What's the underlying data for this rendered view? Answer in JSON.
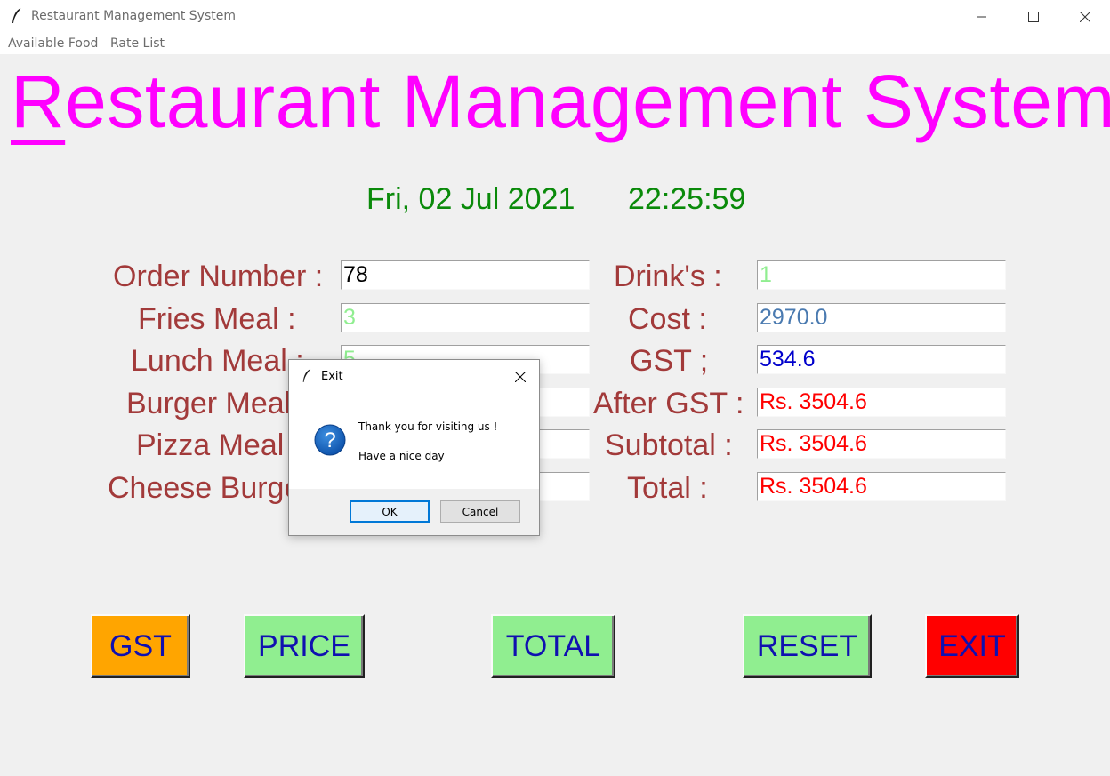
{
  "window": {
    "title": "Restaurant Management System"
  },
  "menu": {
    "items": [
      "Available Food",
      "Rate List"
    ]
  },
  "heading": {
    "first_letter": "R",
    "rest": "estaurant Management System"
  },
  "datetime": {
    "date": "Fri, 02 Jul 2021",
    "time": "22:25:59"
  },
  "fields_left": [
    {
      "label": "Order Number :",
      "value": "78",
      "color": "#000000"
    },
    {
      "label": "Fries Meal :",
      "value": "3",
      "color": "#90ee90"
    },
    {
      "label": "Lunch Meal :",
      "value": "5",
      "color": "#90ee90"
    },
    {
      "label": "Burger Meal :",
      "value": "",
      "color": "#90ee90"
    },
    {
      "label": "Pizza Meal :",
      "value": "",
      "color": "#90ee90"
    },
    {
      "label": "Cheese Burger :",
      "value": "",
      "color": "#90ee90"
    }
  ],
  "fields_right": [
    {
      "label": "Drink's :",
      "value": "1",
      "color": "#90ee90"
    },
    {
      "label": "Cost :",
      "value": "2970.0",
      "color": "#4a7ab0"
    },
    {
      "label": "GST ;",
      "value": "534.6",
      "color": "#0000cc"
    },
    {
      "label": "After GST :",
      "value": "Rs. 3504.6",
      "color": "#ff0000"
    },
    {
      "label": "Subtotal :",
      "value": "Rs. 3504.6",
      "color": "#ff0000"
    },
    {
      "label": "Total :",
      "value": "Rs. 3504.6",
      "color": "#ff0000"
    }
  ],
  "buttons": {
    "gst": "GST",
    "price": "PRICE",
    "total": "TOTAL",
    "reset": "RESET",
    "exit": "EXIT"
  },
  "dialog": {
    "title": "Exit",
    "message_line1": "Thank you for visiting us !",
    "message_line2": "Have a nice day",
    "ok": "OK",
    "cancel": "Cancel",
    "icon": "question-icon"
  },
  "colors": {
    "heading": "#ff00ff",
    "datetime": "#0a8a0a",
    "label": "#a23a3a",
    "button_text": "#1010b0",
    "gst_button": "#ffa500",
    "green_button": "#90ee90",
    "exit_button": "#ff0000"
  }
}
